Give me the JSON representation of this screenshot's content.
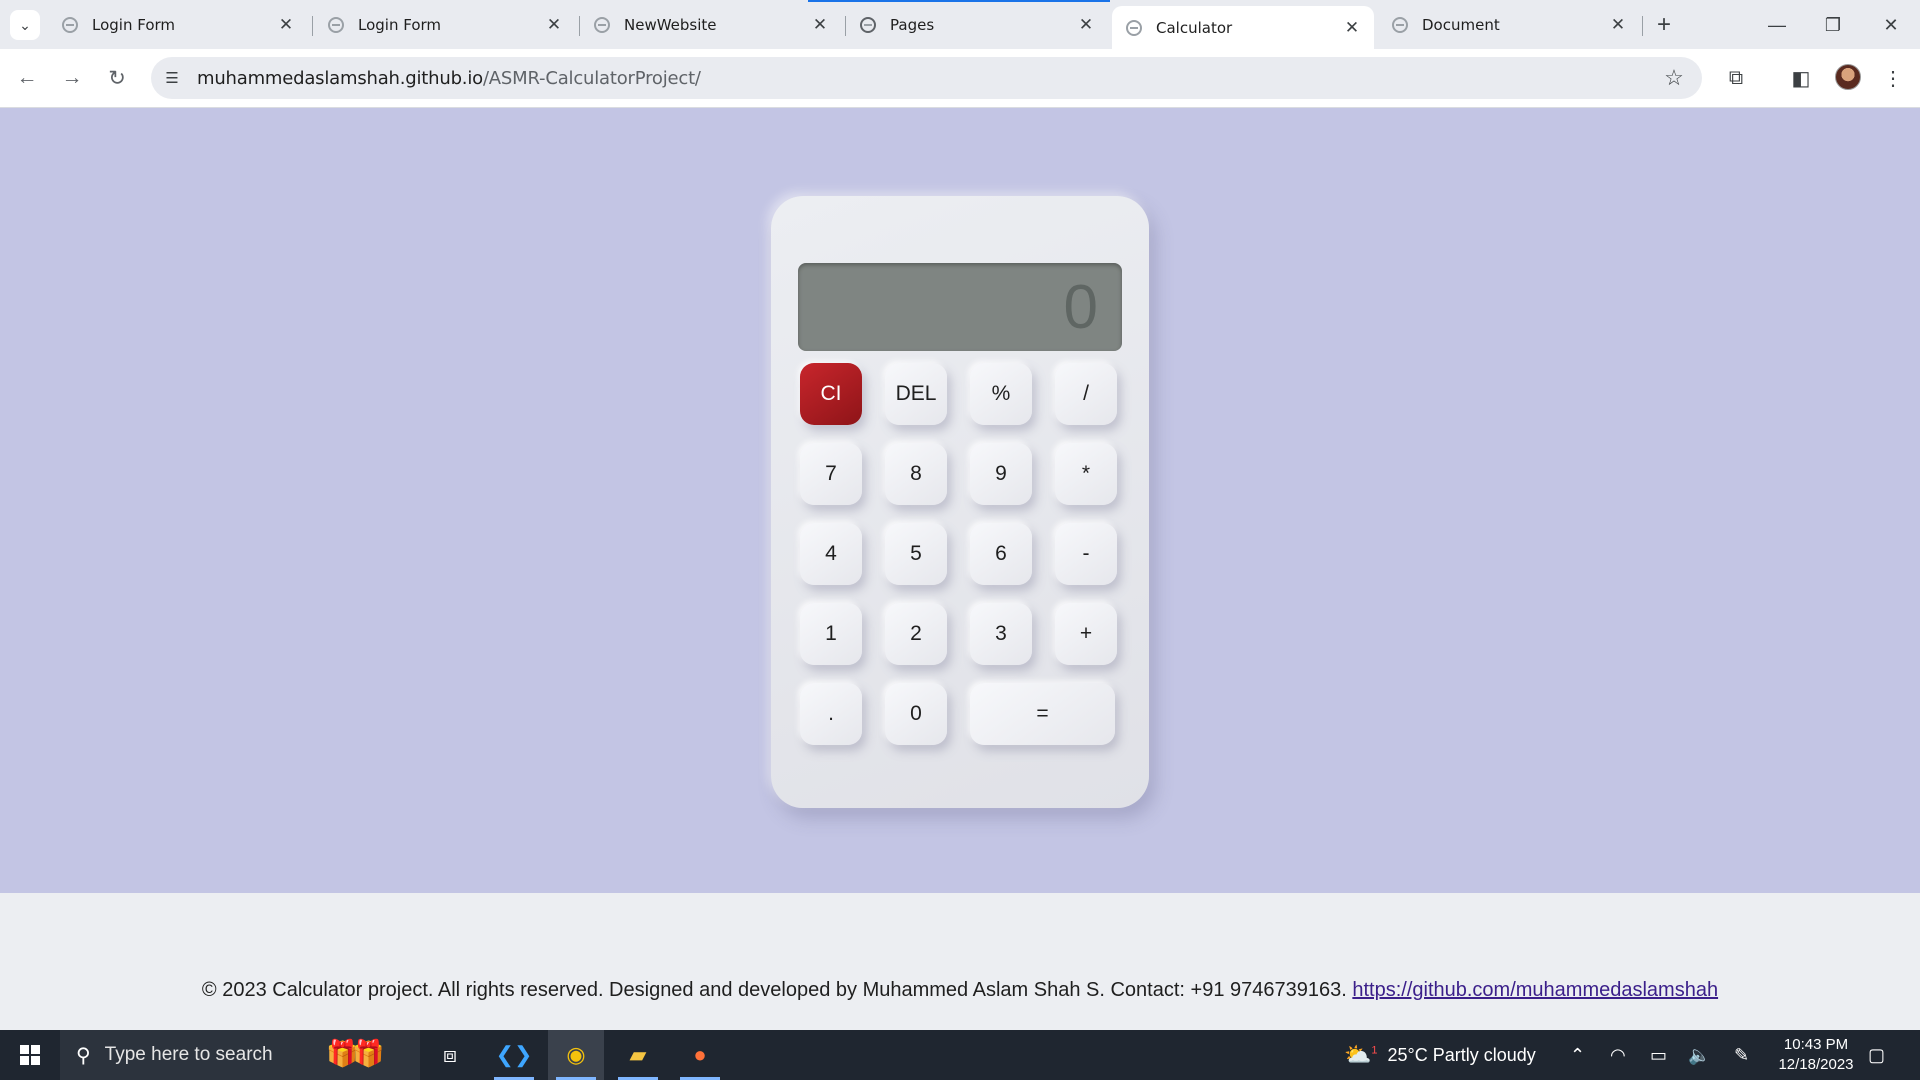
{
  "browser": {
    "tabs": [
      {
        "title": "Login Form",
        "active": false
      },
      {
        "title": "Login Form",
        "active": false
      },
      {
        "title": "NewWebsite",
        "active": false
      },
      {
        "title": "Pages",
        "active": false
      },
      {
        "title": "Calculator",
        "active": true
      },
      {
        "title": "Document",
        "active": false
      }
    ],
    "tab_close_glyph": "✕",
    "new_tab_glyph": "+",
    "url_host": "muhammedaslamshah.github.io",
    "url_path": "/ASMR-CalculatorProject/"
  },
  "calculator": {
    "display": "0",
    "keys": [
      "CI",
      "DEL",
      "%",
      "/",
      "7",
      "8",
      "9",
      "*",
      "4",
      "5",
      "6",
      "-",
      "1",
      "2",
      "3",
      "+",
      ".",
      "0",
      "="
    ],
    "clear_color": "#b01c22"
  },
  "footer": {
    "text": "© 2023 Calculator project. All rights reserved. Designed and developed by Muhammed Aslam Shah S. Contact: +91 9746739163.",
    "link": "https://github.com/muhammedaslamshah"
  },
  "taskbar": {
    "search_placeholder": "Type here to search",
    "weather": "25°C  Partly cloudy",
    "weather_badge": "1",
    "time": "10:43 PM",
    "date": "12/18/2023"
  },
  "colors": {
    "page_bg": "#c3c5e4",
    "footer_bg": "#eceef2",
    "taskbar_bg": "#1f2630",
    "accent": "#1a73e8"
  }
}
